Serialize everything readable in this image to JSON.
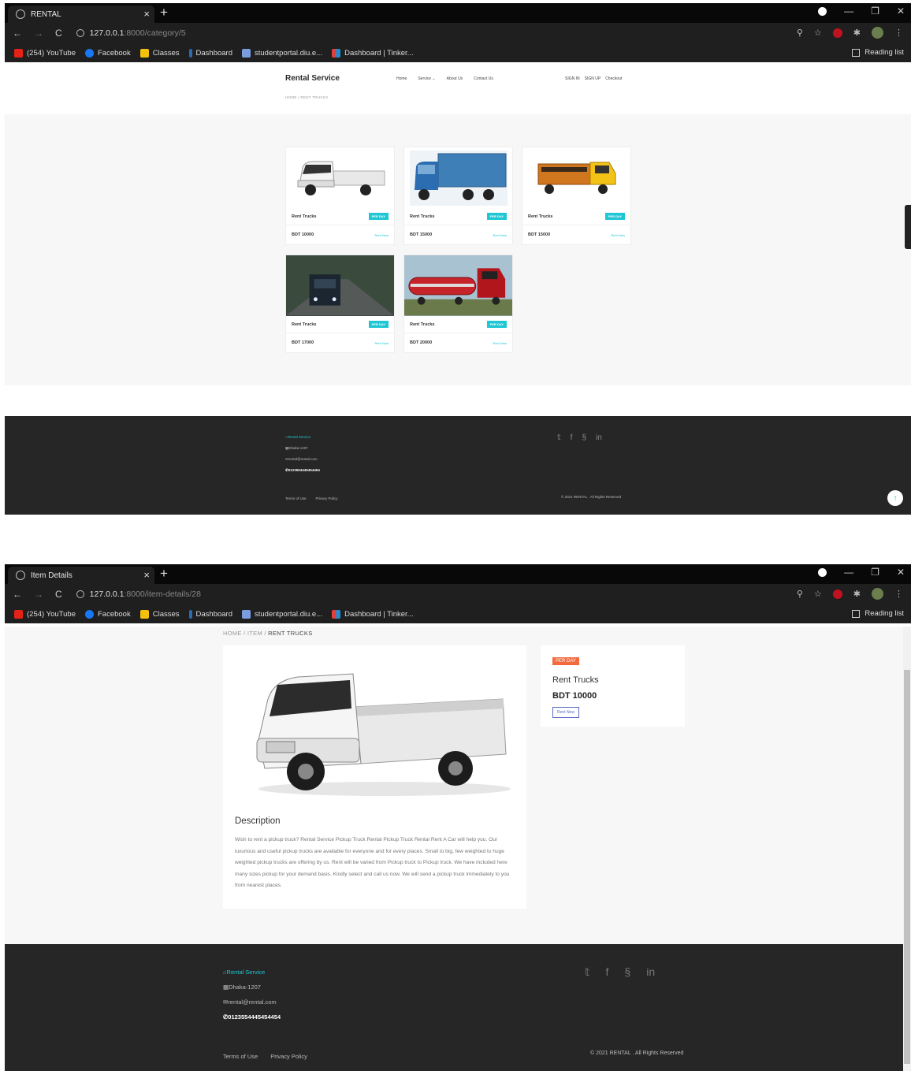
{
  "shot1": {
    "tab": {
      "title": "RENTAL",
      "close": "×",
      "new": "+"
    },
    "url": {
      "host": "127.0.0.1",
      "path": ":8000/category/5"
    },
    "bookmarks": [
      "(254) YouTube",
      "Facebook",
      "Classes",
      "Dashboard",
      "studentportal.diu.e...",
      "Dashboard | Tinker..."
    ],
    "reading_list": "Reading list",
    "brand": "Rental Service",
    "nav": [
      "Home",
      "Service ⌄",
      "About Us",
      "Contact Us"
    ],
    "auth": [
      "SIGN IN",
      "SIGN UP",
      "Checkout"
    ],
    "breadcrumb": "HOME  /  RENT TRUCKS",
    "cards": [
      {
        "title": "Rent Trucks",
        "badge": "PER DAY",
        "price": "BDT 10000",
        "action": "Rent Now"
      },
      {
        "title": "Rent Trucks",
        "badge": "PER DAY",
        "price": "BDT 15000",
        "action": "Rent Now"
      },
      {
        "title": "Rent Trucks",
        "badge": "PER DAY",
        "price": "BDT 15000",
        "action": "Rent Now"
      },
      {
        "title": "Rent Trucks",
        "badge": "PER DAY",
        "price": "BDT 17000",
        "action": "Rent Now"
      },
      {
        "title": "Rent Trucks",
        "badge": "PER DAY",
        "price": "BDT 20000",
        "action": "Rent Now"
      }
    ],
    "footer": {
      "brand": "Rental Service",
      "address": "Dhaka-1207",
      "email": "rental@rental.com",
      "phone": "0123554445454454",
      "links": [
        "Terms of Use",
        "Privacy Policy"
      ],
      "copyright": "© 2021 RENTAL . All Rights Reserved"
    }
  },
  "shot2": {
    "tab": {
      "title": "Item Details",
      "close": "×",
      "new": "+"
    },
    "url": {
      "host": "127.0.0.1",
      "path": ":8000/item-details/28"
    },
    "breadcrumb": {
      "home": "HOME",
      "item": "ITEM",
      "current": "RENT TRUCKS"
    },
    "description": {
      "heading": "Description",
      "text": "Wish to rent a pickup truck? Rental Service Pickup Truck Rental Pickup Truck Rental Rent A Car will help you. Our luxurious and useful pickup trucks are available for everyone and for every places. Small to big, few weighted to huge weighted pickup trucks are offering by us. Rent will be varied from Pickup truck to Pickup truck. We have included here many sizes pickup for your demand basis. Kindly select and call us now. We will send a pickup truck immediately to you from nearest places."
    },
    "side": {
      "badge": "PER DAY",
      "title": "Rent Trucks",
      "price": "BDT 10000",
      "button": "Rent Now"
    },
    "footer": {
      "brand": "Rental Service",
      "address": "Dhaka-1207",
      "email": "rental@rental.com",
      "phone": "0123554445454454",
      "links": [
        "Terms of Use",
        "Privacy Policy"
      ],
      "copyright": "© 2021 RENTAL . All Rights Reserved"
    }
  },
  "colors": {
    "accent": "#1fc7d4",
    "badge_orange": "#f26a3e",
    "footer": "#262626",
    "button_border": "#5b6bc7"
  }
}
